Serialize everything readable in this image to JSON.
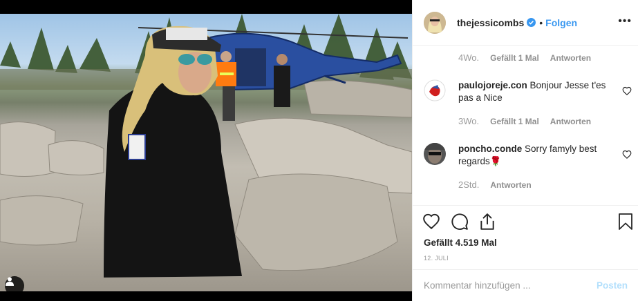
{
  "post": {
    "username": "thejessicombs",
    "follow_label": "Folgen",
    "separator": "•",
    "more_icon": "ellipsis-icon",
    "verified_icon": "verified-badge-icon",
    "photo_description_icon": "user-tag-icon"
  },
  "comments": [
    {
      "username": "",
      "text": "",
      "time": "4Wo.",
      "likes": "Gefällt 1 Mal",
      "reply": "Antworten"
    },
    {
      "username": "paulojoreje.con",
      "text": "Bonjour Jesse t'es pas a Nice",
      "time": "3Wo.",
      "likes": "Gefällt 1 Mal",
      "reply": "Antworten"
    },
    {
      "username": "poncho.conde",
      "text": "Sorry famyly best regards🌹",
      "time": "2Std.",
      "likes": "",
      "reply": "Antworten"
    }
  ],
  "actions": {
    "like_icon": "heart-icon",
    "comment_icon": "comment-icon",
    "share_icon": "share-icon",
    "save_icon": "bookmark-icon",
    "likes_text": "Gefällt 4.519 Mal",
    "date": "12. JULI"
  },
  "add_comment": {
    "placeholder": "Kommentar hinzufügen ...",
    "post_label": "Posten"
  },
  "colors": {
    "accent": "#3897f0",
    "post_disabled": "#b2dffc",
    "muted": "#8e8e8e",
    "text": "#262626"
  }
}
